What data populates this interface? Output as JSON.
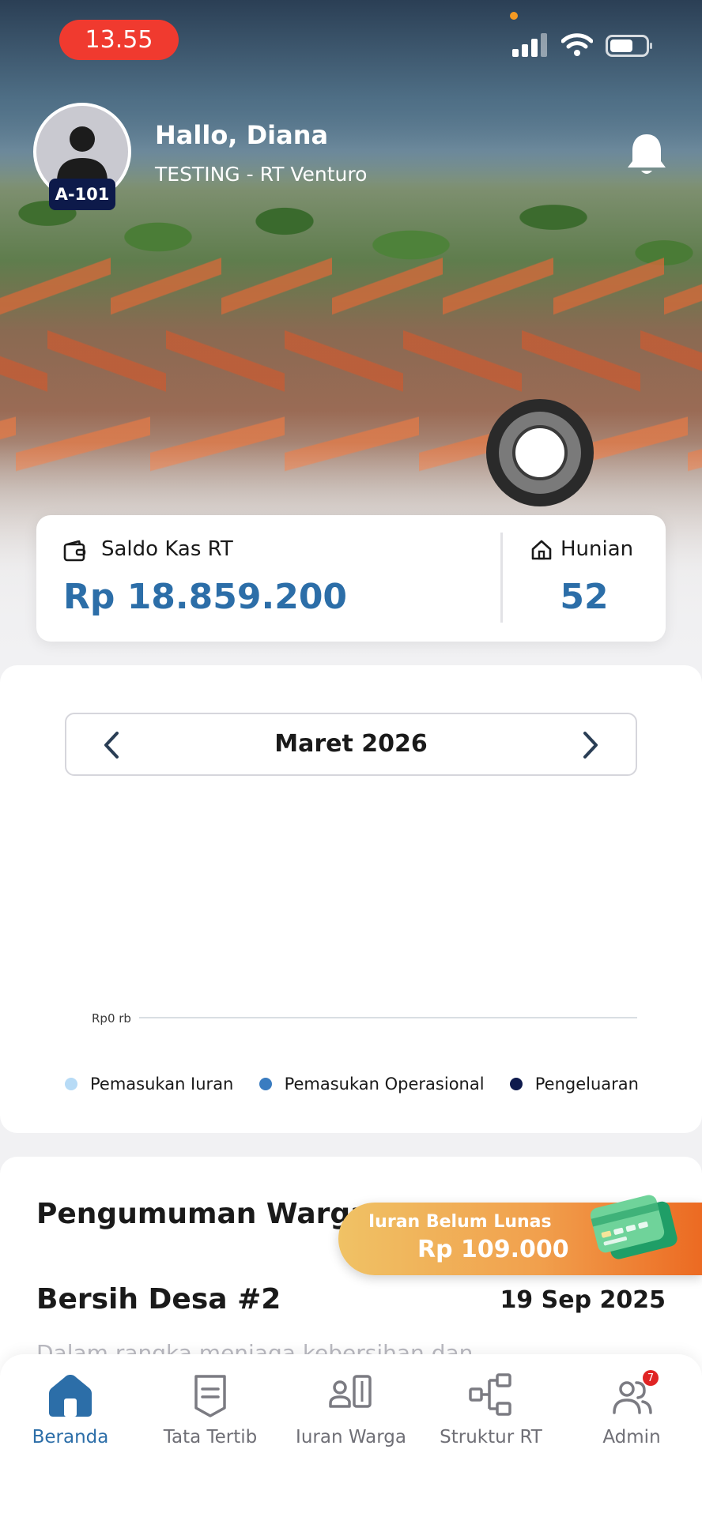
{
  "status_bar": {
    "time": "13.55"
  },
  "profile": {
    "greeting": "Hallo, Diana",
    "organization": "TESTING - RT Venturo",
    "unit": "A-101"
  },
  "saldo": {
    "label": "Saldo Kas RT",
    "value": "Rp 18.859.200",
    "hunian_label": "Hunian",
    "hunian_value": "52"
  },
  "chart_card": {
    "month": "Maret 2026"
  },
  "chart_data": {
    "type": "bar",
    "categories": [],
    "series": [
      {
        "name": "Pemasukan Iuran",
        "color": "#b7dbf6",
        "values": []
      },
      {
        "name": "Pemasukan Operasional",
        "color": "#3a7cc0",
        "values": []
      },
      {
        "name": "Pengeluaran",
        "color": "#0e1a4d",
        "values": []
      }
    ],
    "y_tick_labels": [
      "Rp0 rb"
    ],
    "legend_position": "bottom"
  },
  "announcements": {
    "title": "Pengumuman Warga",
    "item_title": "Bersih Desa #2",
    "item_date": "19 Sep 2025",
    "item_body": "Dalam rangka menjaga kebersihan dan"
  },
  "iuran_banner": {
    "label": "Iuran Belum Lunas",
    "value": "Rp 109.000"
  },
  "bottom_nav": {
    "items": [
      {
        "label": "Beranda",
        "icon": "home-icon",
        "active": true
      },
      {
        "label": "Tata Tertib",
        "icon": "document-icon"
      },
      {
        "label": "Iuran Warga",
        "icon": "payment-icon"
      },
      {
        "label": "Struktur RT",
        "icon": "org-structure-icon"
      },
      {
        "label": "Admin",
        "icon": "users-icon",
        "badge": "7"
      }
    ]
  },
  "colors": {
    "primary": "#2c6ea8",
    "badge_bg": "#0d1a4a",
    "time_pill": "#f03a2f",
    "banner_start": "#f0c265",
    "banner_end": "#ec6a22"
  }
}
